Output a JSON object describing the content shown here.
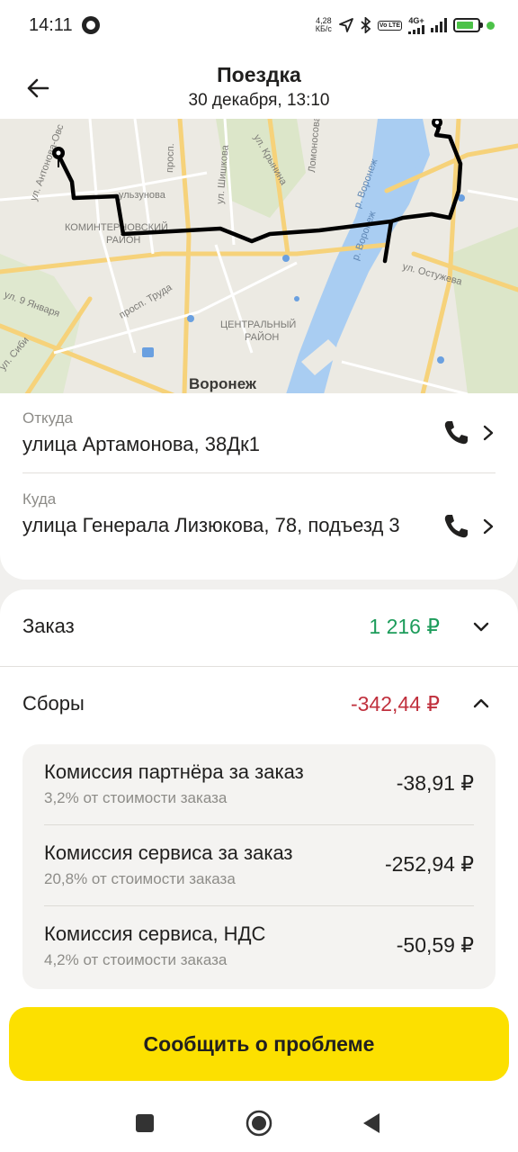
{
  "status_bar": {
    "time": "14:11",
    "net_speed_value": "4,28",
    "net_speed_unit": "КБ/с",
    "volte": "Vo LTE",
    "network": "4G+"
  },
  "header": {
    "title": "Поездка",
    "subtitle": "30 декабря, 13:10"
  },
  "map": {
    "labels": {
      "street_antonova": "ул. Антонова-Овс",
      "street_kuznova": "ульзунова",
      "district_komintern": "КОМИНТЕРНОВСКИЙ",
      "district_komintern_2": "РАЙОН",
      "street_shishkova": "ул. Шишкова",
      "street_prosp": "просп.",
      "street_krynina": "ул. Крынина",
      "street_lomonosova": "Ломоносова",
      "river_1": "р. Воронеж",
      "river_2": "р. Воронеж",
      "street_ostuzheva": "ул. Остужева",
      "street_9jan": "ул. 9 Января",
      "street_truda": "просп. Труда",
      "district_central": "ЦЕНТРАЛЬНЫЙ",
      "district_central_2": "РАЙОН",
      "city": "Воронеж",
      "street_sib": "ул. Сиби"
    }
  },
  "route": {
    "from_label": "Откуда",
    "from_address": "улица Артамонова, 38Дк1",
    "to_label": "Куда",
    "to_address": "улица Генерала Лизюкова, 78, подъезд 3"
  },
  "order": {
    "label": "Заказ",
    "value": "1 216 ₽",
    "value_color": "#1d9c5b"
  },
  "fees": {
    "label": "Сборы",
    "value": "-342,44 ₽",
    "value_color": "#c0303d",
    "items": [
      {
        "title": "Комиссия партнёра за заказ",
        "note": "3,2% от стоимости заказа",
        "amount": "-38,91 ₽"
      },
      {
        "title": "Комиссия сервиса за заказ",
        "note": "20,8% от стоимости заказа",
        "amount": "-252,94 ₽"
      },
      {
        "title": "Комиссия сервиса, НДС",
        "note": "4,2% от стоимости заказа",
        "amount": "-50,59 ₽"
      }
    ]
  },
  "actions": {
    "report_label": "Сообщить о проблеме",
    "report_color": "#fce000"
  },
  "icons": {
    "back": "arrow-left-icon",
    "phone": "phone-icon",
    "chevron_right": "chevron-right-icon",
    "chevron_down": "chevron-down-icon",
    "chevron_up": "chevron-up-icon"
  }
}
